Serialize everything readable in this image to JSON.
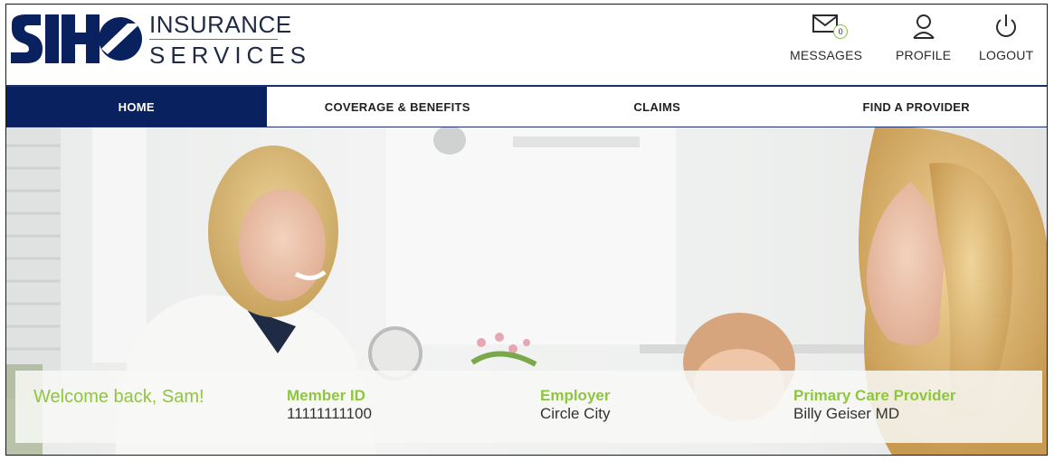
{
  "brand": {
    "mark": "SIHO",
    "line1": "INSURANCE",
    "line2": "SERVICES",
    "colors": {
      "navy": "#0a2160",
      "green": "#8ec63f"
    }
  },
  "utility": {
    "messages": {
      "label": "MESSAGES",
      "count": "0",
      "icon": "envelope-icon"
    },
    "profile": {
      "label": "PROFILE",
      "icon": "user-icon"
    },
    "logout": {
      "label": "LOGOUT",
      "icon": "power-icon"
    }
  },
  "nav": {
    "active": "HOME",
    "items": [
      {
        "label": "HOME"
      },
      {
        "label": "COVERAGE & BENEFITS"
      },
      {
        "label": "CLAIMS"
      },
      {
        "label": "FIND A PROVIDER"
      }
    ]
  },
  "member": {
    "welcome": "Welcome back, Sam!",
    "member_id_label": "Member ID",
    "member_id": "11111111100",
    "employer_label": "Employer",
    "employer": "Circle City",
    "pcp_label": "Primary Care Provider",
    "pcp": "Billy Geiser MD"
  }
}
